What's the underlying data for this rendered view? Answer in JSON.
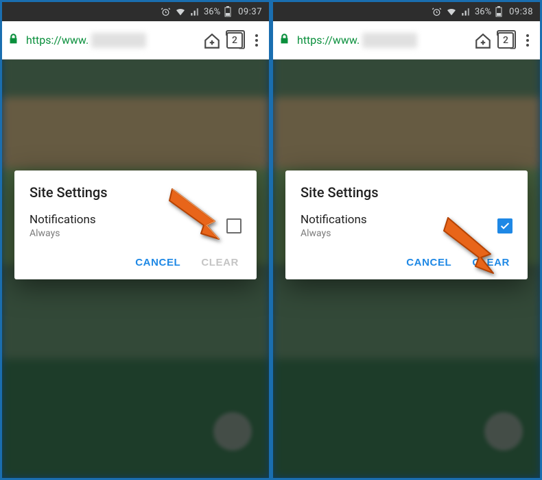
{
  "left": {
    "status": {
      "battery_pct": "36%",
      "time": "09:37"
    },
    "urlbar": {
      "url_prefix": "https://www.",
      "tab_count": "2"
    },
    "dialog": {
      "title": "Site Settings",
      "row_label": "Notifications",
      "row_sub": "Always",
      "checked": false,
      "cancel": "CANCEL",
      "clear": "CLEAR",
      "clear_enabled": false
    }
  },
  "right": {
    "status": {
      "battery_pct": "36%",
      "time": "09:38"
    },
    "urlbar": {
      "url_prefix": "https://www.",
      "tab_count": "2"
    },
    "dialog": {
      "title": "Site Settings",
      "row_label": "Notifications",
      "row_sub": "Always",
      "checked": true,
      "cancel": "CANCEL",
      "clear": "CLEAR",
      "clear_enabled": true
    }
  }
}
